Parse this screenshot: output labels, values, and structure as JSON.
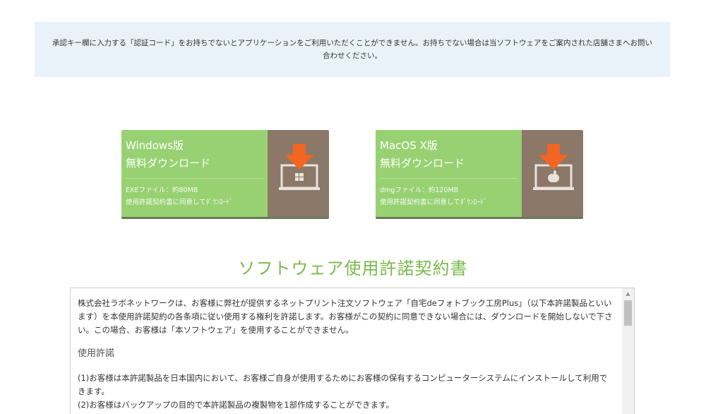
{
  "notice": {
    "text": "承認キー欄に入力する「認証コード」をお持ちでないとアプリケーションをご利用いただくことができません。お持ちでない場合は当ソフトウェアをご案内された店舗さまへお問い合わせください。"
  },
  "downloads": [
    {
      "title": "Windows版",
      "subtitle": "無料ダウンロード",
      "file_info": "EXEファイル：約80MB",
      "agree_note": "使用許諾契約書に同意してﾀﾞｳﾝﾛｰﾄﾞ",
      "icon": "windows-laptop-download-icon"
    },
    {
      "title": "MacOS X版",
      "subtitle": "無料ダウンロード",
      "file_info": "dmgファイル：約120MB",
      "agree_note": "使用許諾契約書に同意してﾀﾞｳﾝﾛｰﾄﾞ",
      "icon": "apple-laptop-download-icon"
    }
  ],
  "license": {
    "heading": "ソフトウェア使用許諾契約書",
    "intro": "株式会社ラボネットワークは、お客様に弊社が提供するネットプリント注文ソフトウェア「自宅deフォトブック工房Plus」（以下本許諾製品といいます）を本使用許諾契約の各条項に従い使用する権利を許諾します。お客様がこの契約に同意できない場合には、ダウンロードを開始しないで下さい。この場合、お客様は「本ソフトウェア」を使用することができません。",
    "section_title": "使用許諾",
    "clause1": "(1)お客様は本許諾製品を日本国内において、お客様ご自身が使用するためにお客様の保有するコンピューターシステムにインストールして利用できます。",
    "clause2": "(2)お客様はバックアップの目的で本許諾製品の複製物を1部作成することができます。"
  },
  "colors": {
    "notice_bg": "#e8f2f8",
    "button_green": "#98d172",
    "button_brown": "#8b7868",
    "arrow_orange": "#f26522",
    "heading_green": "#7ab94b"
  }
}
